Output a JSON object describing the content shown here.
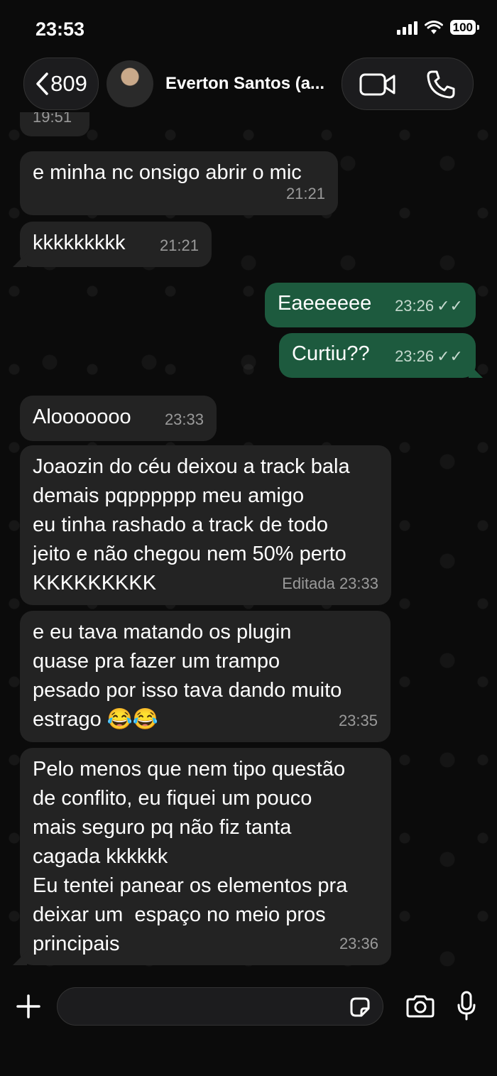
{
  "status_bar": {
    "time": "23:53",
    "battery": "100"
  },
  "header": {
    "back_count": "809",
    "contact_name": "Everton Santos (a..."
  },
  "messages": [
    {
      "direction": "in",
      "text": "e minha nc onsigo abrir o mic",
      "time": "21:21"
    },
    {
      "direction": "in",
      "text": "kkkkkkkkk",
      "time": "21:21"
    },
    {
      "direction": "out",
      "text": "Eaeeeeee",
      "time": "23:26",
      "status": "read"
    },
    {
      "direction": "out",
      "text": "Curtiu??",
      "time": "23:26",
      "status": "read"
    },
    {
      "direction": "in",
      "text": "Alooooooo",
      "time": "23:33"
    },
    {
      "direction": "in",
      "text": "Joaozin do céu deixou a track bala\ndemais pqpppppp meu amigo\neu tinha rashado a track de todo\njeito e não chegou nem 50% perto\nKKKKKKKKK",
      "time": "Editada 23:33"
    },
    {
      "direction": "in",
      "text": "e eu tava matando os plugin\nquase pra fazer um trampo\npesado por isso tava dando muito\nestrago 😂😂",
      "time": "23:35"
    },
    {
      "direction": "in",
      "text": "Pelo menos que nem tipo questão\nde conflito, eu fiquei um pouco\nmais seguro pq não fiz tanta\ncagada kkkkkk\nEu tentei panear os elementos pra\ndeixar um  espaço no meio pros\nprincipais",
      "time": "23:36"
    }
  ],
  "previous_timestamp": "19:51",
  "icons": {
    "back": "chevron-left-icon",
    "video": "video-camera-icon",
    "phone": "phone-icon",
    "plus": "plus-icon",
    "sticker": "sticker-icon",
    "camera": "camera-icon",
    "mic": "microphone-icon"
  },
  "colors": {
    "incoming_bubble": "#232323",
    "outgoing_bubble": "#1d5a3e",
    "background": "#0b0b0b"
  }
}
